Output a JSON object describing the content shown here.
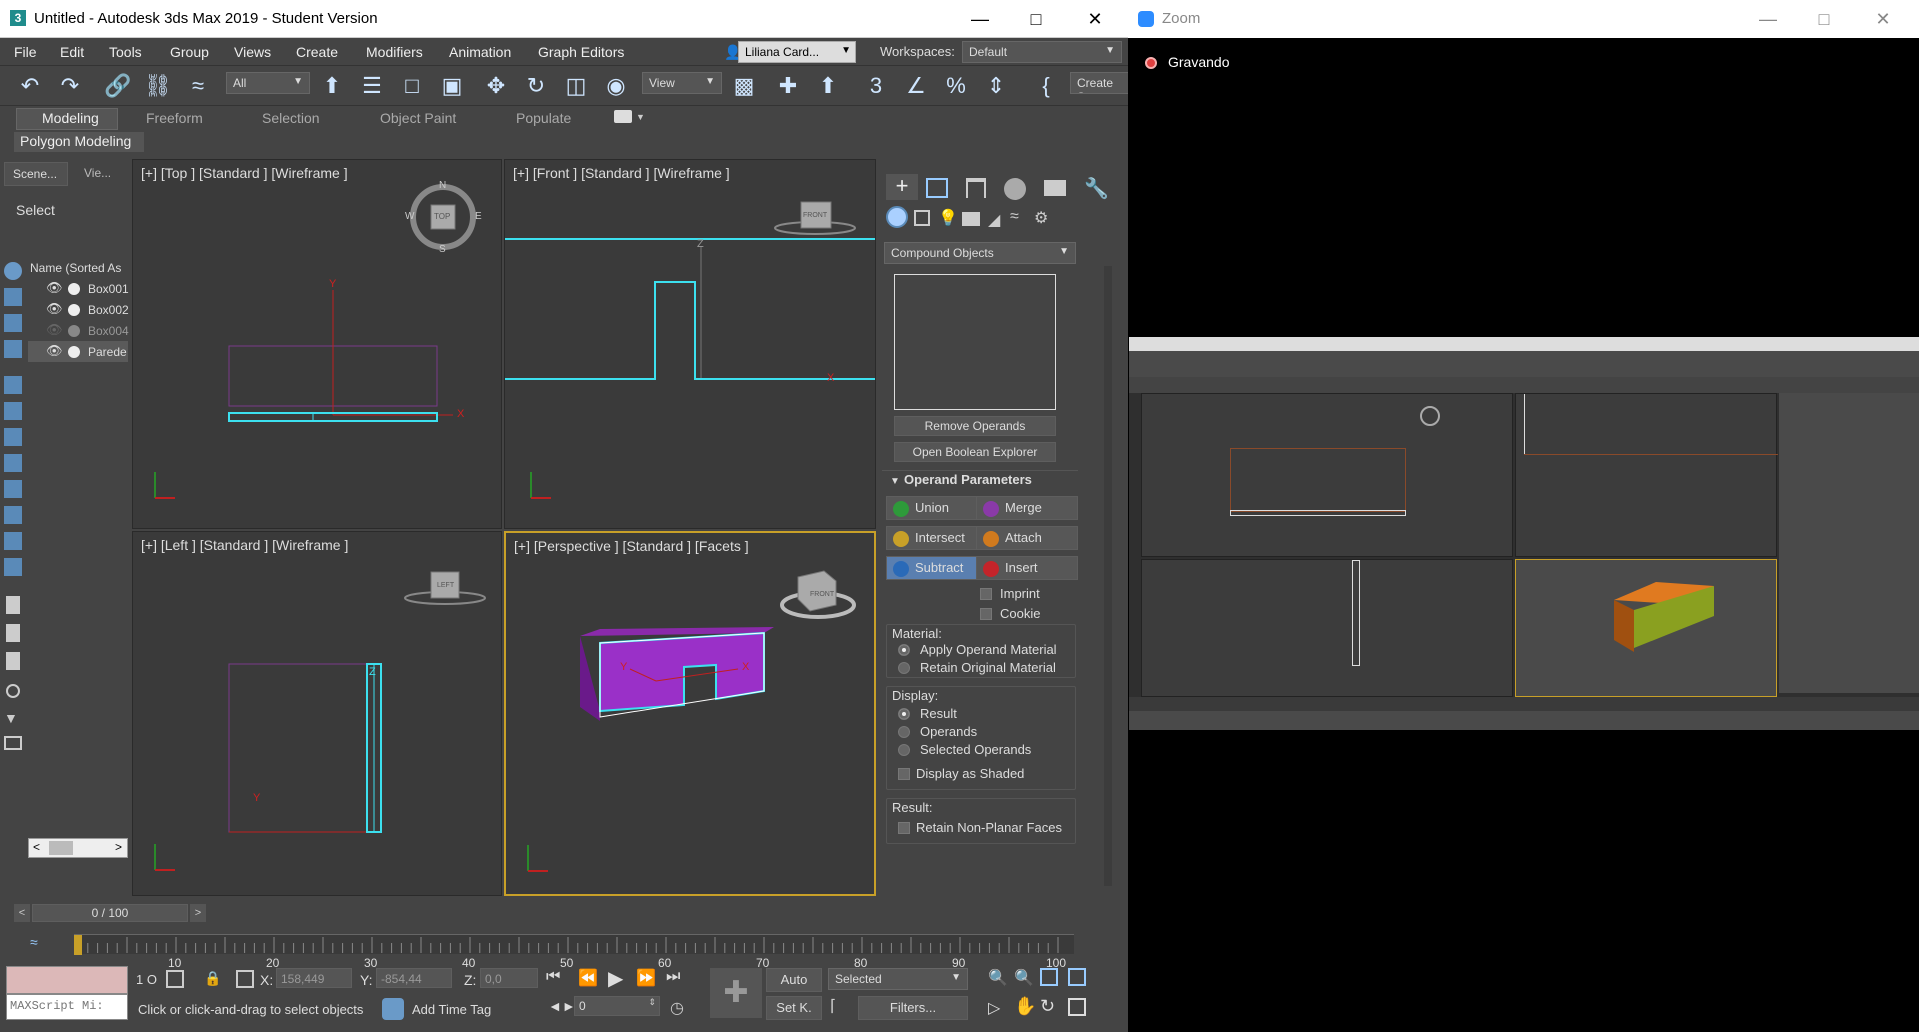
{
  "app": {
    "title": "Untitled - Autodesk 3ds Max 2019 - Student Version",
    "menus": [
      "File",
      "Edit",
      "Tools",
      "Group",
      "Views",
      "Create",
      "Modifiers",
      "Animation",
      "Graph Editors"
    ],
    "user": "Liliana Card...",
    "workspaces_label": "Workspaces:",
    "workspaces_value": "Default",
    "selection_filter": "All",
    "ref_coord": "View",
    "create_sel": "Create S"
  },
  "ribbon": {
    "tabs": [
      "Modeling",
      "Freeform",
      "Selection",
      "Object Paint",
      "Populate"
    ],
    "active": "Modeling",
    "subtitle": "Polygon Modeling"
  },
  "explorer": {
    "tabs": [
      "Scene...",
      "Vie..."
    ],
    "select_label": "Select",
    "header": "Name (Sorted As",
    "items": [
      "Box001",
      "Box002",
      "Box004",
      "Parede"
    ]
  },
  "viewports": {
    "top": "[+] [Top ] [Standard ] [Wireframe ]",
    "front": "[+] [Front ] [Standard ] [Wireframe ]",
    "left": "[+] [Left ] [Standard ] [Wireframe ]",
    "persp": "[+] [Perspective ] [Standard ] [Facets ]",
    "compass": {
      "n": "N",
      "s": "S",
      "e": "E",
      "w": "W",
      "cube": "TOP"
    },
    "front_cube": "FRONT",
    "left_cube": "LEFT",
    "persp_cube": "FRONT",
    "axis": {
      "x": "X",
      "y": "Y",
      "z": "Z"
    }
  },
  "command_panel": {
    "dropdown": "Compound Objects",
    "remove_operands": "Remove Operands",
    "open_explorer": "Open Boolean Explorer",
    "rollout_title": "Operand Parameters",
    "ops": [
      {
        "label": "Union",
        "color": "#2e9a3a"
      },
      {
        "label": "Merge",
        "color": "#8a3aa8"
      },
      {
        "label": "Intersect",
        "color": "#c8a028"
      },
      {
        "label": "Attach",
        "color": "#d07a1e"
      },
      {
        "label": "Subtract",
        "color": "#2a6ab8"
      },
      {
        "label": "Insert",
        "color": "#c4242a"
      }
    ],
    "imprint": "Imprint",
    "cookie": "Cookie",
    "material_label": "Material:",
    "material_opts": [
      "Apply Operand Material",
      "Retain Original Material"
    ],
    "display_label": "Display:",
    "display_opts": [
      "Result",
      "Operands",
      "Selected Operands"
    ],
    "display_shaded": "Display as Shaded",
    "result_label": "Result:",
    "retain_faces": "Retain Non-Planar Faces"
  },
  "timeline": {
    "counter": "0 / 100",
    "ticks": [
      "10",
      "20",
      "30",
      "40",
      "50",
      "60",
      "70",
      "80",
      "90",
      "100"
    ]
  },
  "status": {
    "maxscript": "MAXScript Mi:",
    "selected_count": "1 O",
    "x_label": "X:",
    "x_value": "158,449",
    "y_label": "Y:",
    "y_value": "-854,44",
    "z_label": "Z:",
    "z_value": "0,0",
    "message": "Click or click-and-drag to select objects",
    "add_time_tag": "Add Time Tag",
    "auto": "Auto",
    "set_key": "Set K.",
    "selected_dropdown": "Selected",
    "filters": "Filters...",
    "frame": "0"
  },
  "zoom": {
    "title": "Zoom",
    "recording": "Gravando"
  }
}
